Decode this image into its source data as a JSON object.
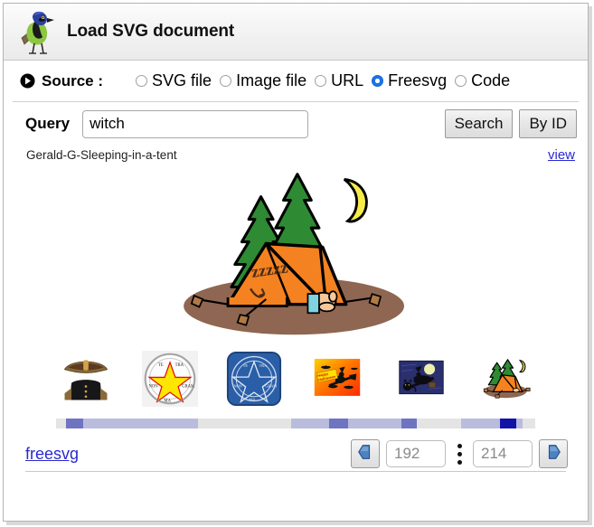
{
  "window": {
    "title": "Load SVG document",
    "app_icon": "green-jay-bird-icon"
  },
  "source": {
    "label": "Source :",
    "bullet_icon": "circle-arrow-right-icon",
    "options": [
      {
        "label": "SVG file",
        "selected": false
      },
      {
        "label": "Image file",
        "selected": false
      },
      {
        "label": "URL",
        "selected": false
      },
      {
        "label": "Freesvg",
        "selected": true
      },
      {
        "label": "Code",
        "selected": false
      }
    ],
    "selected_value": "Freesvg"
  },
  "query": {
    "label": "Query",
    "value": "witch",
    "placeholder": "",
    "search_button": "Search",
    "by_id_button": "By ID"
  },
  "result": {
    "name": "Gerald-G-Sleeping-in-a-tent",
    "view_link": "view"
  },
  "preview": {
    "alt": "sleeping-in-a-tent-illustration",
    "zzz_text": "zzzzz"
  },
  "thumbnails": [
    {
      "name": "bicorne-hat-and-vest",
      "selected": false
    },
    {
      "name": "pentacle-seal-color",
      "selected": false
    },
    {
      "name": "pentacle-seal-blue",
      "selected": false
    },
    {
      "name": "happy-halloween-witch",
      "selected": false
    },
    {
      "name": "witch-flying-night",
      "selected": false
    },
    {
      "name": "sleeping-in-a-tent",
      "selected": true
    }
  ],
  "strip": {
    "segments": [
      {
        "left_pct": 2.0,
        "width_pct": 3.6,
        "tone": "mid"
      },
      {
        "left_pct": 5.6,
        "width_pct": 24.0,
        "tone": "light"
      },
      {
        "left_pct": 49.0,
        "width_pct": 8.0,
        "tone": "light"
      },
      {
        "left_pct": 57.0,
        "width_pct": 4.0,
        "tone": "mid"
      },
      {
        "left_pct": 61.0,
        "width_pct": 11.0,
        "tone": "light"
      },
      {
        "left_pct": 72.0,
        "width_pct": 3.2,
        "tone": "mid"
      },
      {
        "left_pct": 84.6,
        "width_pct": 8.0,
        "tone": "light"
      },
      {
        "left_pct": 92.6,
        "width_pct": 3.4,
        "tone": "dark"
      },
      {
        "left_pct": 96.0,
        "width_pct": 1.4,
        "tone": "light"
      }
    ]
  },
  "footer": {
    "site_link": "freesvg",
    "prev_icon": "arrow-left-icon",
    "next_icon": "arrow-right-icon",
    "current_page": "192",
    "total_pages": "214",
    "separator_icon": "vertical-ellipsis-icon"
  },
  "colors": {
    "accent_blue": "#1a73e8",
    "link_blue": "#2a2ad0",
    "strip_dark": "#1212a8",
    "strip_mid": "#6f74c0",
    "strip_light": "#b9bcdd",
    "tent_orange": "#f58220",
    "tree_green": "#2e8b33",
    "moon_yellow": "#f5ec4a",
    "ground_brown": "#8f6651"
  }
}
